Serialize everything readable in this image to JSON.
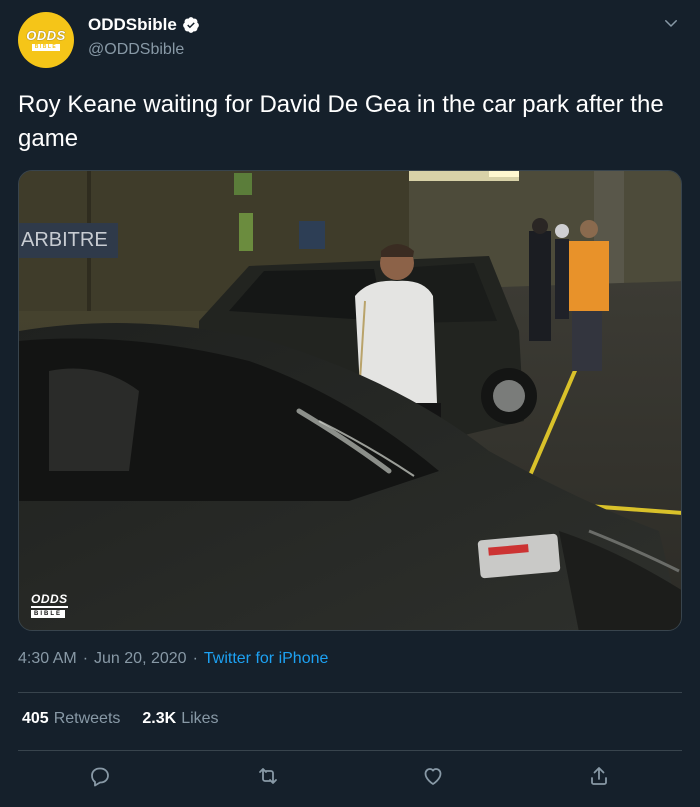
{
  "user": {
    "display_name": "ODDSbible",
    "handle": "@ODDSbible",
    "avatar_logo_top": "ODDS",
    "avatar_logo_bottom": "BIBLE",
    "verified": true
  },
  "tweet": {
    "text": "Roy Keane waiting for David De Gea in the car park after the game",
    "time": "4:30 AM",
    "separator": "·",
    "date": "Jun 20, 2020",
    "source": "Twitter for iPhone"
  },
  "media": {
    "sign_text": "ARBITRE",
    "watermark_top": "ODDS",
    "watermark_bottom": "BIBLE"
  },
  "stats": {
    "retweets_count": "405",
    "retweets_label": "Retweets",
    "likes_count": "2.3K",
    "likes_label": "Likes"
  },
  "icons": {
    "verified": "verified-badge-icon",
    "caret": "chevron-down-icon",
    "reply": "reply-icon",
    "retweet": "retweet-icon",
    "like": "heart-icon",
    "share": "share-icon"
  },
  "colors": {
    "background": "#15202b",
    "secondary_text": "#8899a6",
    "accent": "#1da1f2",
    "divider": "#38444d",
    "avatar": "#f5c518"
  }
}
